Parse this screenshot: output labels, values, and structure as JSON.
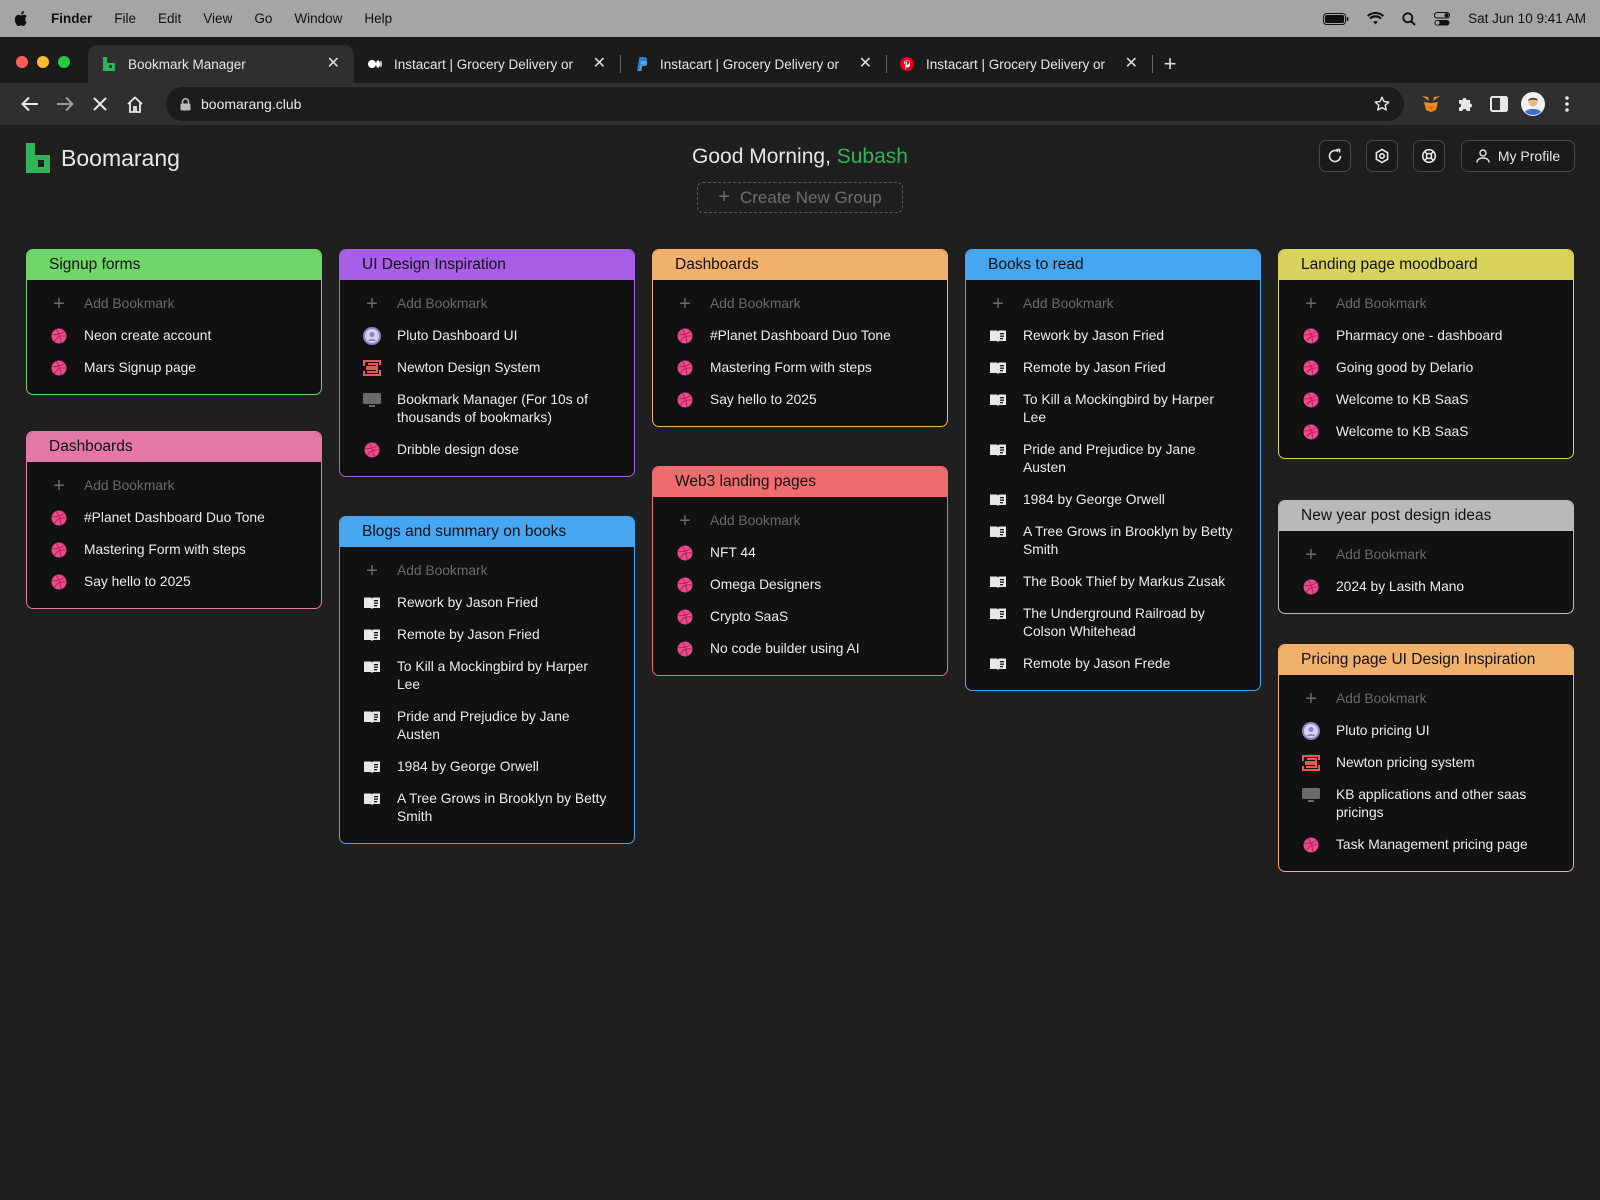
{
  "menubar": {
    "app": "Finder",
    "items": [
      "File",
      "Edit",
      "View",
      "Go",
      "Window",
      "Help"
    ],
    "datetime": "Sat Jun 10  9:41 AM"
  },
  "browser": {
    "tabs": [
      {
        "title": "Bookmark Manager",
        "favicon": "boomarang-icon",
        "active": true
      },
      {
        "title": "Instacart | Grocery Delivery or",
        "favicon": "medium-icon",
        "active": false
      },
      {
        "title": "Instacart | Grocery Delivery or",
        "favicon": "paypal-icon",
        "active": false
      },
      {
        "title": "Instacart | Grocery Delivery or",
        "favicon": "pinterest-icon",
        "active": false
      }
    ],
    "url": "boomarang.club"
  },
  "app": {
    "logo_light": "Boo",
    "logo_bold": "marang",
    "greeting_prefix": "Good Morning, ",
    "user_name": "Subash",
    "create_group": "Create New Group",
    "profile_label": "My Profile",
    "accent": "#2fb45a"
  },
  "groups": [
    {
      "title": "Signup forms",
      "color": "#6fd66a",
      "add": "Add Bookmark",
      "items": [
        {
          "label": "Neon create account",
          "icon": "dribbble-icon"
        },
        {
          "label": "Mars Signup page",
          "icon": "dribbble-icon"
        }
      ]
    },
    {
      "title": "Dashboards",
      "color": "#e277a8",
      "add": "Add Bookmark",
      "items": [
        {
          "label": "#Planet Dashboard Duo Tone",
          "icon": "dribbble-icon"
        },
        {
          "label": "Mastering Form with steps",
          "icon": "dribbble-icon"
        },
        {
          "label": "Say hello to 2025",
          "icon": "dribbble-icon"
        }
      ]
    },
    {
      "title": "UI Design Inspiration",
      "color": "#a95ee8",
      "add": "Add Bookmark",
      "items": [
        {
          "label": "Pluto Dashboard UI",
          "icon": "avatar-icon"
        },
        {
          "label": "Newton Design System",
          "icon": "newton-icon"
        },
        {
          "label": "Bookmark Manager (For 10s of thousands of bookmarks)",
          "icon": "monitor-icon"
        },
        {
          "label": "Dribble design dose",
          "icon": "dribbble-icon"
        }
      ]
    },
    {
      "title": "Blogs and summary on books",
      "color": "#47a6f0",
      "add": "Add Bookmark",
      "items": [
        {
          "label": "Rework by Jason Fried",
          "icon": "book-icon"
        },
        {
          "label": "Remote by Jason Fried",
          "icon": "book-icon"
        },
        {
          "label": "To Kill a Mockingbird by Harper Lee",
          "icon": "book-icon"
        },
        {
          "label": "Pride and Prejudice by Jane Austen",
          "icon": "book-icon"
        },
        {
          "label": "1984 by George Orwell",
          "icon": "book-icon"
        },
        {
          "label": "A Tree Grows in Brooklyn by Betty Smith",
          "icon": "book-icon"
        }
      ]
    },
    {
      "title": "Dashboards",
      "color": "#f1b06b",
      "add": "Add Bookmark",
      "items": [
        {
          "label": "#Planet Dashboard Duo Tone",
          "icon": "dribbble-icon"
        },
        {
          "label": "Mastering Form with steps",
          "icon": "dribbble-icon"
        },
        {
          "label": "Say hello to 2025",
          "icon": "dribbble-icon"
        }
      ]
    },
    {
      "title": "Web3 landing pages",
      "color": "#ef6c6c",
      "add": "Add Bookmark",
      "items": [
        {
          "label": "NFT 44",
          "icon": "dribbble-icon"
        },
        {
          "label": "Omega Designers",
          "icon": "dribbble-icon"
        },
        {
          "label": "Crypto SaaS",
          "icon": "dribbble-icon"
        },
        {
          "label": "No code builder using AI",
          "icon": "dribbble-icon"
        }
      ]
    },
    {
      "title": "Books to read",
      "color": "#47a6f0",
      "add": "Add Bookmark",
      "items": [
        {
          "label": "Rework by Jason Fried",
          "icon": "book-icon"
        },
        {
          "label": "Remote by Jason Fried",
          "icon": "book-icon"
        },
        {
          "label": "To Kill a Mockingbird by Harper Lee",
          "icon": "book-icon"
        },
        {
          "label": "Pride and Prejudice by Jane Austen",
          "icon": "book-icon"
        },
        {
          "label": "1984 by George Orwell",
          "icon": "book-icon"
        },
        {
          "label": "A Tree Grows in Brooklyn by Betty Smith",
          "icon": "book-icon"
        },
        {
          "label": "The Book Thief by Markus Zusak",
          "icon": "book-icon"
        },
        {
          "label": "The Underground Railroad by Colson Whitehead",
          "icon": "book-icon"
        },
        {
          "label": "Remote by Jason Frede",
          "icon": "book-icon"
        }
      ]
    },
    {
      "title": "Landing page moodboard",
      "color": "#d8d35b",
      "add": "Add Bookmark",
      "items": [
        {
          "label": "Pharmacy one - dashboard",
          "icon": "dribbble-icon"
        },
        {
          "label": "Going good by Delario",
          "icon": "dribbble-icon"
        },
        {
          "label": "Welcome to KB SaaS",
          "icon": "dribbble-icon"
        },
        {
          "label": "Welcome to KB SaaS",
          "icon": "dribbble-icon"
        }
      ]
    },
    {
      "title": "New year post design ideas",
      "color": "#b9b9b9",
      "add": "Add Bookmark",
      "items": [
        {
          "label": "2024 by Lasith Mano",
          "icon": "dribbble-icon"
        }
      ]
    },
    {
      "title": "Pricing page UI Design Inspiration",
      "color": "#f1b06b",
      "add": "Add Bookmark",
      "items": [
        {
          "label": "Pluto pricing UI",
          "icon": "avatar-icon"
        },
        {
          "label": "Newton pricing system",
          "icon": "newton-icon"
        },
        {
          "label": "KB applications and other saas pricings",
          "icon": "monitor-icon"
        },
        {
          "label": "Task Management pricing page",
          "icon": "dribbble-icon"
        }
      ]
    }
  ]
}
